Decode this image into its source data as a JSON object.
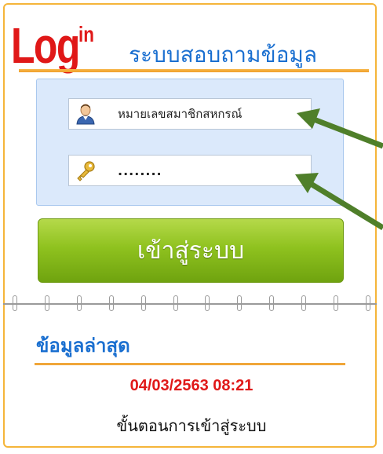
{
  "header": {
    "logo_main": "Log",
    "logo_sup": "in",
    "system_title": "ระบบสอบถามข้อมูล"
  },
  "login": {
    "member_field": {
      "value": "หมายเลขสมาชิกสหกรณ์",
      "icon": "user-icon"
    },
    "password_field": {
      "value": "........",
      "icon": "key-icon"
    },
    "button_label": "เข้าสู่ระบบ"
  },
  "news": {
    "title": "ข้อมูลล่าสุด",
    "date": "04/03/2563 08:21",
    "item": "ขั้นตอนการเข้าสู่ระบบ"
  },
  "colors": {
    "accent_orange": "#f0a02c",
    "title_blue": "#1a6fd0",
    "logo_red": "#e01818",
    "button_green": "#8fc21f",
    "box_blue": "#dbe9fb",
    "arrow_green": "#4f7f2a"
  }
}
